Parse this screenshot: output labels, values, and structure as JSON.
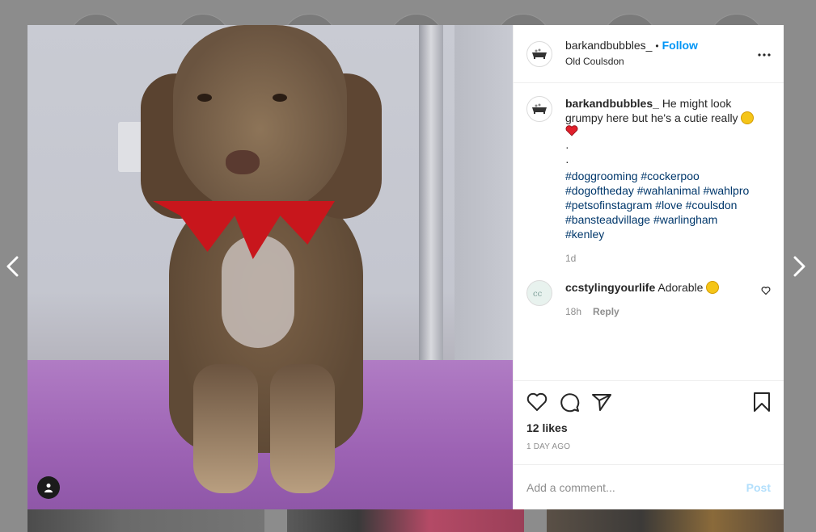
{
  "post": {
    "username": "barkandbubbles_",
    "follow_label": "Follow",
    "location": "Old Coulsdon",
    "caption_text": "He might look grumpy here but he's a cutie really",
    "caption_dots": [
      "·",
      "·"
    ],
    "hashtags": "#doggrooming #cockerpoo #dogoftheday #wahlanimal #wahlpro #petsofinstagram #love #coulsdon #bansteadvillage #warlingham #kenley",
    "caption_age": "1d",
    "likes": "12 likes",
    "post_time": "1 DAY AGO"
  },
  "comments": [
    {
      "username": "ccstylingyourlife",
      "text": "Adorable",
      "age": "18h",
      "reply_label": "Reply"
    }
  ],
  "comment_box": {
    "placeholder": "Add a comment...",
    "post_label": "Post"
  },
  "icons": {
    "prev": "chevron-left-icon",
    "next": "chevron-right-icon",
    "more": "more-options-icon",
    "like": "heart-icon",
    "comment": "comment-icon",
    "share": "send-icon",
    "save": "bookmark-icon",
    "tagged": "user-tag-icon"
  },
  "colors": {
    "accent": "#0095f6",
    "hashtag": "#00376b",
    "muted": "#8e8e8e",
    "post_disabled": "#b2dffc"
  }
}
